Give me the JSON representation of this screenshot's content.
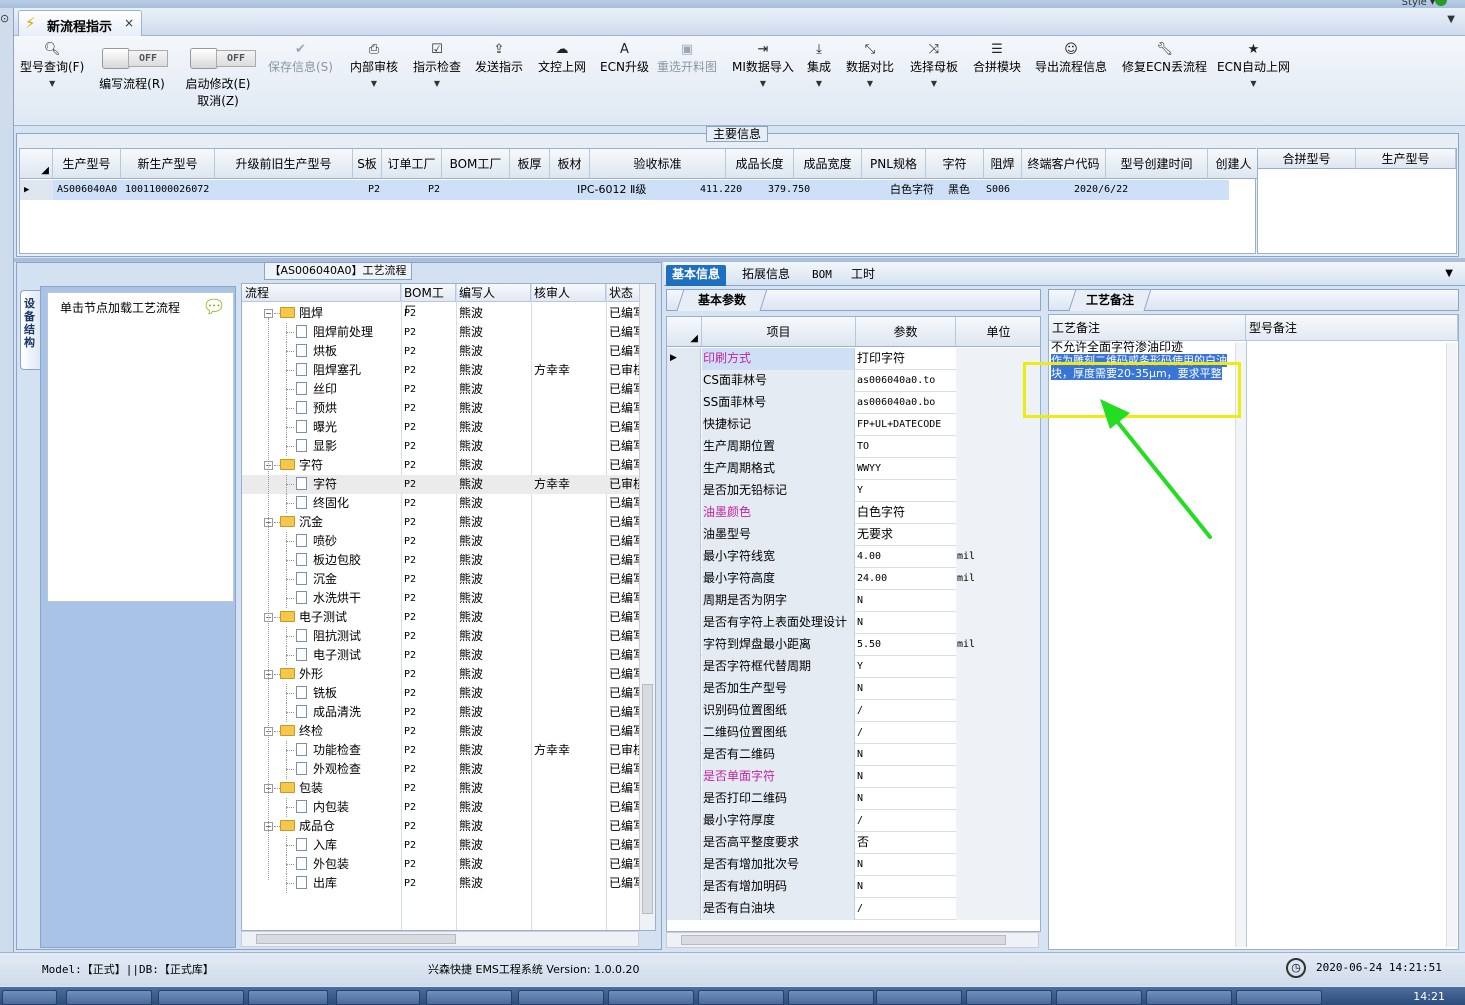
{
  "window": {
    "style_label": "Style"
  },
  "tab": {
    "title": "新流程指示",
    "close": "×"
  },
  "toolbar": {
    "model_query": "型号查询(F)",
    "write_flow": "编写流程(R)",
    "toggle_off": "OFF",
    "enable_edit": "启动修改(E)",
    "cancel": "取消(Z)",
    "save_info": "保存信息(S)",
    "internal_review": "内部审核",
    "check_instruction": "指示检查",
    "send_instruction": "发送指示",
    "upload_online": "文控上网",
    "ecn_upgrade": "ECN升级",
    "reselect_image": "重选开料图",
    "mi_import": "MI数据导入",
    "integrate": "集成",
    "data_compare": "数据对比",
    "select_master": "选择母板",
    "merge_module": "合拼模块",
    "export_flow": "导出流程信息",
    "fix_ecn": "修复ECN丢流程",
    "ecn_auto": "ECN自动上网"
  },
  "main_info": {
    "label": "主要信息",
    "columns": [
      "生产型号",
      "新生产型号",
      "升级前旧生产型号",
      "S板",
      "订单工厂",
      "BOM工厂",
      "板厚",
      "板材",
      "验收标准",
      "成品长度",
      "成品宽度",
      "PNL规格",
      "字符",
      "阻焊",
      "终端客户代码",
      "型号创建时间",
      "创建人"
    ],
    "row": {
      "model": "AS006040A0",
      "new_model": "10011000026072",
      "order_factory": "P2",
      "bom_factory": "P2",
      "standard": "IPC-6012 Ⅱ级",
      "length": "411.220",
      "width": "379.750",
      "char": "白色字符",
      "solder": "黑色",
      "customer": "S006",
      "created": "2020/6/22"
    },
    "side_columns": [
      "合拼型号",
      "生产型号"
    ]
  },
  "left": {
    "vtab": "设备结构",
    "node_hint": "单击节点加载工艺流程",
    "flow_title": "【AS006040A0】工艺流程",
    "tree_columns": [
      "流程",
      "BOM工厂",
      "编写人",
      "核审人",
      "状态"
    ],
    "rows": [
      {
        "name": "阻焊",
        "folder": true,
        "level": 0,
        "bom": "P2",
        "writer": "熊波",
        "reviewer": "",
        "status": "已编写"
      },
      {
        "name": "阻焊前处理",
        "folder": false,
        "level": 1,
        "bom": "P2",
        "writer": "熊波",
        "reviewer": "",
        "status": "已编写"
      },
      {
        "name": "烘板",
        "folder": false,
        "level": 1,
        "bom": "P2",
        "writer": "熊波",
        "reviewer": "",
        "status": "已编写"
      },
      {
        "name": "阻焊塞孔",
        "folder": false,
        "level": 1,
        "bom": "P2",
        "writer": "熊波",
        "reviewer": "方幸幸",
        "status": "已审核"
      },
      {
        "name": "丝印",
        "folder": false,
        "level": 1,
        "bom": "P2",
        "writer": "熊波",
        "reviewer": "",
        "status": "已编写"
      },
      {
        "name": "预烘",
        "folder": false,
        "level": 1,
        "bom": "P2",
        "writer": "熊波",
        "reviewer": "",
        "status": "已编写"
      },
      {
        "name": "曝光",
        "folder": false,
        "level": 1,
        "bom": "P2",
        "writer": "熊波",
        "reviewer": "",
        "status": "已编写"
      },
      {
        "name": "显影",
        "folder": false,
        "level": 1,
        "bom": "P2",
        "writer": "熊波",
        "reviewer": "",
        "status": "已编写"
      },
      {
        "name": "字符",
        "folder": true,
        "level": 0,
        "bom": "P2",
        "writer": "熊波",
        "reviewer": "",
        "status": "已编写"
      },
      {
        "name": "字符",
        "folder": false,
        "level": 1,
        "bom": "P2",
        "writer": "熊波",
        "reviewer": "方幸幸",
        "status": "已审核",
        "selected": true
      },
      {
        "name": "终固化",
        "folder": false,
        "level": 1,
        "bom": "P2",
        "writer": "熊波",
        "reviewer": "",
        "status": "已编写"
      },
      {
        "name": "沉金",
        "folder": true,
        "level": 0,
        "bom": "P2",
        "writer": "熊波",
        "reviewer": "",
        "status": "已编写"
      },
      {
        "name": "喷砂",
        "folder": false,
        "level": 1,
        "bom": "P2",
        "writer": "熊波",
        "reviewer": "",
        "status": "已编写"
      },
      {
        "name": "板边包胶",
        "folder": false,
        "level": 1,
        "bom": "P2",
        "writer": "熊波",
        "reviewer": "",
        "status": "已编写"
      },
      {
        "name": "沉金",
        "folder": false,
        "level": 1,
        "bom": "P2",
        "writer": "熊波",
        "reviewer": "",
        "status": "已编写"
      },
      {
        "name": "水洗烘干",
        "folder": false,
        "level": 1,
        "bom": "P2",
        "writer": "熊波",
        "reviewer": "",
        "status": "已编写"
      },
      {
        "name": "电子测试",
        "folder": true,
        "level": 0,
        "bom": "P2",
        "writer": "熊波",
        "reviewer": "",
        "status": "已编写"
      },
      {
        "name": "阻抗测试",
        "folder": false,
        "level": 1,
        "bom": "P2",
        "writer": "熊波",
        "reviewer": "",
        "status": "已编写"
      },
      {
        "name": "电子测试",
        "folder": false,
        "level": 1,
        "bom": "P2",
        "writer": "熊波",
        "reviewer": "",
        "status": "已编写"
      },
      {
        "name": "外形",
        "folder": true,
        "level": 0,
        "bom": "P2",
        "writer": "熊波",
        "reviewer": "",
        "status": "已编写"
      },
      {
        "name": "铣板",
        "folder": false,
        "level": 1,
        "bom": "P2",
        "writer": "熊波",
        "reviewer": "",
        "status": "已编写"
      },
      {
        "name": "成品清洗",
        "folder": false,
        "level": 1,
        "bom": "P2",
        "writer": "熊波",
        "reviewer": "",
        "status": "已编写"
      },
      {
        "name": "终检",
        "folder": true,
        "level": 0,
        "bom": "P2",
        "writer": "熊波",
        "reviewer": "",
        "status": "已编写"
      },
      {
        "name": "功能检查",
        "folder": false,
        "level": 1,
        "bom": "P2",
        "writer": "熊波",
        "reviewer": "方幸幸",
        "status": "已审核"
      },
      {
        "name": "外观检查",
        "folder": false,
        "level": 1,
        "bom": "P2",
        "writer": "熊波",
        "reviewer": "",
        "status": "已编写"
      },
      {
        "name": "包装",
        "folder": true,
        "level": 0,
        "bom": "P2",
        "writer": "熊波",
        "reviewer": "",
        "status": "已编写"
      },
      {
        "name": "内包装",
        "folder": false,
        "level": 1,
        "bom": "P2",
        "writer": "熊波",
        "reviewer": "",
        "status": "已编写"
      },
      {
        "name": "成品仓",
        "folder": true,
        "level": 0,
        "bom": "P2",
        "writer": "熊波",
        "reviewer": "",
        "status": "已编写"
      },
      {
        "name": "入库",
        "folder": false,
        "level": 1,
        "bom": "P2",
        "writer": "熊波",
        "reviewer": "",
        "status": "已编写"
      },
      {
        "name": "外包装",
        "folder": false,
        "level": 1,
        "bom": "P2",
        "writer": "熊波",
        "reviewer": "",
        "status": "已编写"
      },
      {
        "name": "出库",
        "folder": false,
        "level": 1,
        "bom": "P2",
        "writer": "熊波",
        "reviewer": "",
        "status": "已编写"
      }
    ]
  },
  "right": {
    "tabs": [
      "基本信息",
      "拓展信息",
      "BOM",
      "工时"
    ],
    "basic_params_tab": "基本参数",
    "param_columns": [
      "项目",
      "参数",
      "单位"
    ],
    "params": [
      {
        "k": "印刷方式",
        "v": "打印字符",
        "u": "",
        "pink": true,
        "hl": true,
        "mono": false
      },
      {
        "k": "CS面菲林号",
        "v": "as006040a0.to",
        "u": "",
        "pink": false,
        "mono": true
      },
      {
        "k": "SS面菲林号",
        "v": "as006040a0.bo",
        "u": "",
        "pink": false,
        "mono": true
      },
      {
        "k": "快捷标记",
        "v": "FP+UL+DATECODE",
        "u": "",
        "pink": false,
        "mono": true
      },
      {
        "k": "生产周期位置",
        "v": "TO",
        "u": "",
        "pink": false,
        "mono": true
      },
      {
        "k": "生产周期格式",
        "v": "WWYY",
        "u": "",
        "pink": false,
        "mono": true
      },
      {
        "k": "是否加无铅标记",
        "v": "Y",
        "u": "",
        "pink": false,
        "mono": true
      },
      {
        "k": "油墨颜色",
        "v": "白色字符",
        "u": "",
        "pink": true,
        "mono": false
      },
      {
        "k": "油墨型号",
        "v": "无要求",
        "u": "",
        "pink": false,
        "mono": false
      },
      {
        "k": "最小字符线宽",
        "v": "4.00",
        "u": "mil",
        "pink": false,
        "mono": true
      },
      {
        "k": "最小字符高度",
        "v": "24.00",
        "u": "mil",
        "pink": false,
        "mono": true
      },
      {
        "k": "周期是否为阴字",
        "v": "N",
        "u": "",
        "pink": false,
        "mono": true
      },
      {
        "k": "是否有字符上表面处理设计",
        "v": "N",
        "u": "",
        "pink": false,
        "mono": true
      },
      {
        "k": "字符到焊盘最小距离",
        "v": "5.50",
        "u": "mil",
        "pink": false,
        "mono": true
      },
      {
        "k": "是否字符框代替周期",
        "v": "Y",
        "u": "",
        "pink": false,
        "mono": true
      },
      {
        "k": "是否加生产型号",
        "v": "N",
        "u": "",
        "pink": false,
        "mono": true
      },
      {
        "k": "识别码位置图纸",
        "v": "/",
        "u": "",
        "pink": false,
        "mono": true
      },
      {
        "k": "二维码位置图纸",
        "v": "/",
        "u": "",
        "pink": false,
        "mono": true
      },
      {
        "k": "是否有二维码",
        "v": "N",
        "u": "",
        "pink": false,
        "mono": true
      },
      {
        "k": "是否单面字符",
        "v": "N",
        "u": "",
        "pink": true,
        "mono": true
      },
      {
        "k": "是否打印二维码",
        "v": "N",
        "u": "",
        "pink": false,
        "mono": true
      },
      {
        "k": "最小字符厚度",
        "v": "/",
        "u": "",
        "pink": false,
        "mono": true
      },
      {
        "k": "是否高平整度要求",
        "v": "否",
        "u": "",
        "pink": false,
        "mono": false
      },
      {
        "k": "是否有增加批次号",
        "v": "N",
        "u": "",
        "pink": false,
        "mono": true
      },
      {
        "k": "是否有增加明码",
        "v": "N",
        "u": "",
        "pink": false,
        "mono": true
      },
      {
        "k": "是否有白油块",
        "v": "/",
        "u": "",
        "pink": false,
        "mono": true
      }
    ],
    "notes_tab": "工艺备注",
    "note_columns": [
      "工艺备注",
      "型号备注"
    ],
    "note_line1": "不允许全面字符渗油印迹",
    "note_line2": "作为雕刻二维码或条形码使用的白油块，厚度需要20-35μm，要求平整"
  },
  "status": {
    "model_db": "Model:【正式】||DB:【正式库】",
    "app": "兴森快捷 EMS工程系统 Version: 1.0.0.20",
    "datetime": "2020-06-24 14:21:51",
    "clock": "14:21"
  },
  "colors": {
    "accent": "#1f6fc0",
    "highlight": "#ecec12",
    "arrow": "#22dd22",
    "selection": "#3875d7"
  }
}
